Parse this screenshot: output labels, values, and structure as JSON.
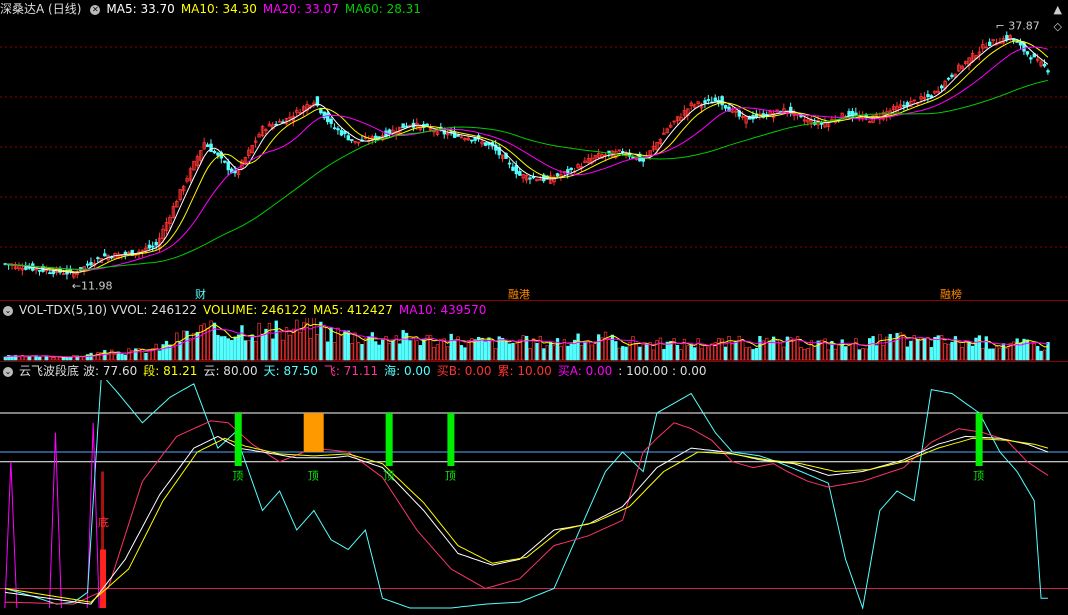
{
  "colors": {
    "up": "#ff3333",
    "down": "#54ffff",
    "ma5": "#ffffff",
    "ma10": "#ffff00",
    "ma20": "#ff00ff",
    "ma60": "#00cc00",
    "grid": "#8b0000",
    "text": "#cccccc",
    "dim": "#8a8a8a"
  },
  "header": {
    "title": "深桑达A (日线)",
    "ma5": "MA5: 33.70",
    "ma10": "MA10: 34.30",
    "ma20": "MA20: 33.07",
    "ma60": "MA60: 28.31",
    "close_icon": "close-icon",
    "menu_icon": "diamond-icon"
  },
  "price_panel": {
    "high_label": "37.87",
    "low_label": "11.98",
    "markers": [
      "财",
      "融港",
      "融榜"
    ]
  },
  "vol_header": {
    "name": "VOL-TDX(5,10)",
    "vvol": "VVOL: 246122",
    "volume": "VOLUME: 246122",
    "ma5": "MA5: 412427",
    "ma10": "MA10: 439570"
  },
  "ind_header": {
    "name": "云飞波段底",
    "bo": "波: 77.60",
    "duan": "段: 81.21",
    "yun": "云: 80.00",
    "tian": "天: 87.50",
    "fei": "飞: 71.11",
    "hai": "海: 0.00",
    "maid": "买B: 0.00",
    "lei": "累: 10.00",
    "maia": "买A: 0.00",
    "tail": ": 100.00 : 0.00"
  },
  "ind_panel": {
    "top_label": "顶",
    "bottom_label": "底"
  },
  "chart_data": [
    {
      "type": "candlestick",
      "title": "深桑达A (日线)",
      "n_bars": 150,
      "ylim": [
        10,
        39
      ],
      "price_anchors": [
        [
          0,
          13.0
        ],
        [
          10,
          12.4
        ],
        [
          20,
          11.98
        ],
        [
          28,
          13.8
        ],
        [
          38,
          14.2
        ],
        [
          44,
          15.0
        ],
        [
          52,
          21.5
        ],
        [
          58,
          26.0
        ],
        [
          62,
          24.5
        ],
        [
          67,
          22.5
        ],
        [
          75,
          27.5
        ],
        [
          82,
          28.5
        ],
        [
          90,
          30.5
        ],
        [
          95,
          27.8
        ],
        [
          102,
          26.0
        ],
        [
          108,
          26.5
        ],
        [
          118,
          28.0
        ],
        [
          128,
          27.0
        ],
        [
          136,
          26.5
        ],
        [
          142,
          25.5
        ],
        [
          150,
          22.5
        ],
        [
          158,
          22.0
        ],
        [
          165,
          23.0
        ],
        [
          172,
          24.5
        ],
        [
          180,
          25.0
        ],
        [
          186,
          24.0
        ],
        [
          193,
          27.5
        ],
        [
          200,
          30.0
        ],
        [
          208,
          30.5
        ],
        [
          215,
          28.5
        ],
        [
          222,
          29.0
        ],
        [
          228,
          29.5
        ],
        [
          232,
          28.5
        ],
        [
          238,
          28.0
        ],
        [
          245,
          29.0
        ],
        [
          252,
          28.5
        ],
        [
          262,
          30.0
        ],
        [
          270,
          31.0
        ],
        [
          278,
          34.0
        ],
        [
          286,
          36.5
        ],
        [
          293,
          37.3
        ],
        [
          298,
          35.5
        ],
        [
          304,
          33.8
        ]
      ],
      "ma_series": [
        {
          "name": "MA5",
          "last": 33.7
        },
        {
          "name": "MA10",
          "last": 34.3
        },
        {
          "name": "MA20",
          "last": 33.07
        },
        {
          "name": "MA60",
          "last": 28.31
        }
      ]
    },
    {
      "type": "bar",
      "title": "VOL-TDX(5,10)",
      "last_volume": 246122,
      "ma5": 412427,
      "ma10": 439570,
      "volume_anchors": [
        [
          0,
          60
        ],
        [
          20,
          60
        ],
        [
          28,
          120
        ],
        [
          38,
          150
        ],
        [
          45,
          220
        ],
        [
          52,
          420
        ],
        [
          58,
          520
        ],
        [
          62,
          470
        ],
        [
          70,
          560
        ],
        [
          80,
          480
        ],
        [
          90,
          620
        ],
        [
          95,
          480
        ],
        [
          105,
          420
        ],
        [
          120,
          380
        ],
        [
          130,
          330
        ],
        [
          150,
          310
        ],
        [
          165,
          330
        ],
        [
          175,
          350
        ],
        [
          190,
          280
        ],
        [
          210,
          310
        ],
        [
          230,
          300
        ],
        [
          245,
          280
        ],
        [
          260,
          350
        ],
        [
          275,
          330
        ],
        [
          290,
          300
        ],
        [
          304,
          246
        ]
      ]
    },
    {
      "type": "line",
      "title": "云飞波段底",
      "ylim": [
        0,
        100
      ],
      "series": [
        {
          "name": "波",
          "last": 77.6
        },
        {
          "name": "段",
          "last": 81.21
        },
        {
          "name": "云",
          "last": 80.0
        },
        {
          "name": "天",
          "last": 87.5
        },
        {
          "name": "飞",
          "last": 71.11
        }
      ],
      "cyan_anchors": [
        [
          0,
          10
        ],
        [
          8,
          6
        ],
        [
          15,
          2
        ],
        [
          20,
          3
        ],
        [
          24,
          8
        ],
        [
          28,
          120
        ],
        [
          33,
          110
        ],
        [
          40,
          95
        ],
        [
          48,
          108
        ],
        [
          55,
          115
        ],
        [
          62,
          82
        ],
        [
          67,
          90
        ],
        [
          75,
          50
        ],
        [
          80,
          60
        ],
        [
          85,
          40
        ],
        [
          90,
          50
        ],
        [
          95,
          35
        ],
        [
          100,
          30
        ],
        [
          105,
          40
        ],
        [
          110,
          5
        ],
        [
          118,
          0
        ],
        [
          130,
          0
        ],
        [
          140,
          2
        ],
        [
          150,
          3
        ],
        [
          160,
          10
        ],
        [
          170,
          50
        ],
        [
          175,
          70
        ],
        [
          180,
          80
        ],
        [
          186,
          70
        ],
        [
          190,
          100
        ],
        [
          195,
          105
        ],
        [
          200,
          110
        ],
        [
          207,
          90
        ],
        [
          212,
          80
        ],
        [
          220,
          78
        ],
        [
          225,
          75
        ],
        [
          232,
          70
        ],
        [
          240,
          64
        ],
        [
          245,
          25
        ],
        [
          250,
          0
        ],
        [
          255,
          50
        ],
        [
          260,
          60
        ],
        [
          265,
          55
        ],
        [
          270,
          112
        ],
        [
          276,
          110
        ],
        [
          284,
          100
        ],
        [
          290,
          80
        ],
        [
          295,
          70
        ],
        [
          300,
          55
        ],
        [
          302,
          5
        ]
      ],
      "pink_anchors": [
        [
          0,
          3
        ],
        [
          20,
          2
        ],
        [
          30,
          10
        ],
        [
          40,
          65
        ],
        [
          50,
          88
        ],
        [
          60,
          96
        ],
        [
          65,
          95
        ],
        [
          72,
          84
        ],
        [
          80,
          75
        ],
        [
          90,
          82
        ],
        [
          100,
          80
        ],
        [
          110,
          67
        ],
        [
          120,
          40
        ],
        [
          130,
          20
        ],
        [
          140,
          10
        ],
        [
          150,
          15
        ],
        [
          160,
          32
        ],
        [
          170,
          37
        ],
        [
          180,
          45
        ],
        [
          186,
          80
        ],
        [
          190,
          87
        ],
        [
          195,
          95
        ],
        [
          200,
          92
        ],
        [
          206,
          86
        ],
        [
          212,
          75
        ],
        [
          218,
          72
        ],
        [
          224,
          74
        ],
        [
          228,
          70
        ],
        [
          234,
          65
        ],
        [
          240,
          62
        ],
        [
          250,
          65
        ],
        [
          262,
          72
        ],
        [
          270,
          85
        ],
        [
          278,
          92
        ],
        [
          285,
          90
        ],
        [
          292,
          86
        ],
        [
          298,
          75
        ],
        [
          304,
          68
        ]
      ],
      "white_anchors": [
        [
          0,
          8
        ],
        [
          25,
          2
        ],
        [
          35,
          25
        ],
        [
          45,
          58
        ],
        [
          55,
          82
        ],
        [
          62,
          88
        ],
        [
          68,
          82
        ],
        [
          75,
          80
        ],
        [
          85,
          77
        ],
        [
          95,
          77
        ],
        [
          100,
          78
        ],
        [
          110,
          72
        ],
        [
          122,
          50
        ],
        [
          132,
          28
        ],
        [
          142,
          22
        ],
        [
          150,
          25
        ],
        [
          160,
          40
        ],
        [
          170,
          43
        ],
        [
          180,
          52
        ],
        [
          190,
          72
        ],
        [
          200,
          82
        ],
        [
          210,
          80
        ],
        [
          220,
          76
        ],
        [
          230,
          74
        ],
        [
          240,
          68
        ],
        [
          250,
          70
        ],
        [
          262,
          76
        ],
        [
          272,
          84
        ],
        [
          280,
          88
        ],
        [
          290,
          87
        ],
        [
          298,
          84
        ],
        [
          304,
          80
        ]
      ],
      "yellow_anchors": [
        [
          0,
          10
        ],
        [
          25,
          3
        ],
        [
          36,
          20
        ],
        [
          46,
          55
        ],
        [
          56,
          80
        ],
        [
          64,
          87
        ],
        [
          70,
          83
        ],
        [
          80,
          79
        ],
        [
          90,
          78
        ],
        [
          100,
          79
        ],
        [
          110,
          74
        ],
        [
          122,
          54
        ],
        [
          132,
          32
        ],
        [
          142,
          23
        ],
        [
          152,
          26
        ],
        [
          162,
          40
        ],
        [
          172,
          44
        ],
        [
          182,
          52
        ],
        [
          192,
          70
        ],
        [
          202,
          80
        ],
        [
          212,
          79
        ],
        [
          222,
          76
        ],
        [
          232,
          74
        ],
        [
          242,
          70
        ],
        [
          252,
          71
        ],
        [
          262,
          75
        ],
        [
          272,
          82
        ],
        [
          282,
          87
        ],
        [
          292,
          86
        ],
        [
          300,
          84
        ],
        [
          304,
          82
        ]
      ],
      "top_marks": [
        [
          68,
          "green"
        ],
        [
          90,
          "orange"
        ],
        [
          112,
          "green"
        ],
        [
          130,
          "green"
        ],
        [
          284,
          "green"
        ]
      ],
      "bottom_marks": [
        [
          28
        ]
      ],
      "ref_lines": [
        100,
        80,
        75,
        10
      ]
    }
  ]
}
